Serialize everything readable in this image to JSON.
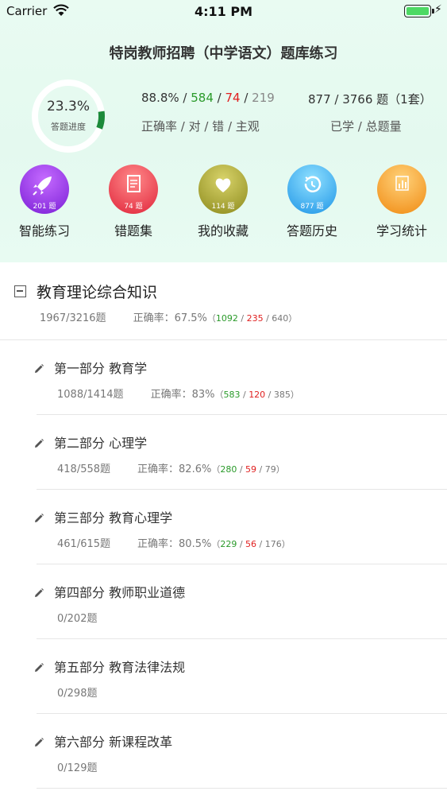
{
  "status_bar": {
    "carrier": "Carrier",
    "time": "4:11 PM"
  },
  "title": "特岗教师招聘（中学语文）题库练习",
  "progress": {
    "percent_text": "23.3%",
    "label": "答题进度",
    "fraction": 0.233
  },
  "accuracy_stats": {
    "rate": "88.8%",
    "sep1": " / ",
    "correct": "584",
    "sep2": " / ",
    "wrong": "74",
    "sep3": " / ",
    "subjective": "219",
    "label": "正确率 / 对 / 错 / 主观"
  },
  "volume_stats": {
    "value": "877 / 3766 题（1套）",
    "label": "已学 / 总题量"
  },
  "actions": [
    {
      "label": "智能练习",
      "count": "201 题",
      "icon": "rocket-icon",
      "color_top": "#c56bff",
      "color_bottom": "#7a1fd6"
    },
    {
      "label": "错题集",
      "count": "74 题",
      "icon": "document-icon",
      "color_top": "#ff8a8a",
      "color_bottom": "#e0243a"
    },
    {
      "label": "我的收藏",
      "count": "114 题",
      "icon": "heart-icon",
      "color_top": "#d8d36a",
      "color_bottom": "#8c8a1c"
    },
    {
      "label": "答题历史",
      "count": "877 题",
      "icon": "history-icon",
      "color_top": "#8fe0ff",
      "color_bottom": "#1f95e6"
    },
    {
      "label": "学习统计",
      "count": "",
      "icon": "bar-chart-icon",
      "color_top": "#ffd27a",
      "color_bottom": "#f08a12"
    }
  ],
  "section": {
    "title": "教育理论综合知识",
    "progress": "1967/3216题",
    "rate_label": "正确率：",
    "rate": "67.5%",
    "open": "（",
    "correct": "1092",
    "sep1": " / ",
    "wrong": "235",
    "sep2": " / ",
    "subjective": "640",
    "close": "）"
  },
  "parts": [
    {
      "title": "第一部分 教育学",
      "progress": "1088/1414题",
      "rate_label": "正确率：",
      "rate": "83%",
      "open": "（",
      "correct": "583",
      "sep1": " / ",
      "wrong": "120",
      "sep2": " / ",
      "subjective": "385",
      "close": "）"
    },
    {
      "title": "第二部分 心理学",
      "progress": "418/558题",
      "rate_label": "正确率：",
      "rate": "82.6%",
      "open": "（",
      "correct": "280",
      "sep1": " / ",
      "wrong": "59",
      "sep2": " / ",
      "subjective": "79",
      "close": "）"
    },
    {
      "title": "第三部分 教育心理学",
      "progress": "461/615题",
      "rate_label": "正确率：",
      "rate": "80.5%",
      "open": "（",
      "correct": "229",
      "sep1": " / ",
      "wrong": "56",
      "sep2": " / ",
      "subjective": "176",
      "close": "）"
    },
    {
      "title": "第四部分 教师职业道德",
      "progress": "0/202题"
    },
    {
      "title": "第五部分 教育法律法规",
      "progress": "0/298题"
    },
    {
      "title": "第六部分 新课程改革",
      "progress": "0/129题"
    }
  ]
}
